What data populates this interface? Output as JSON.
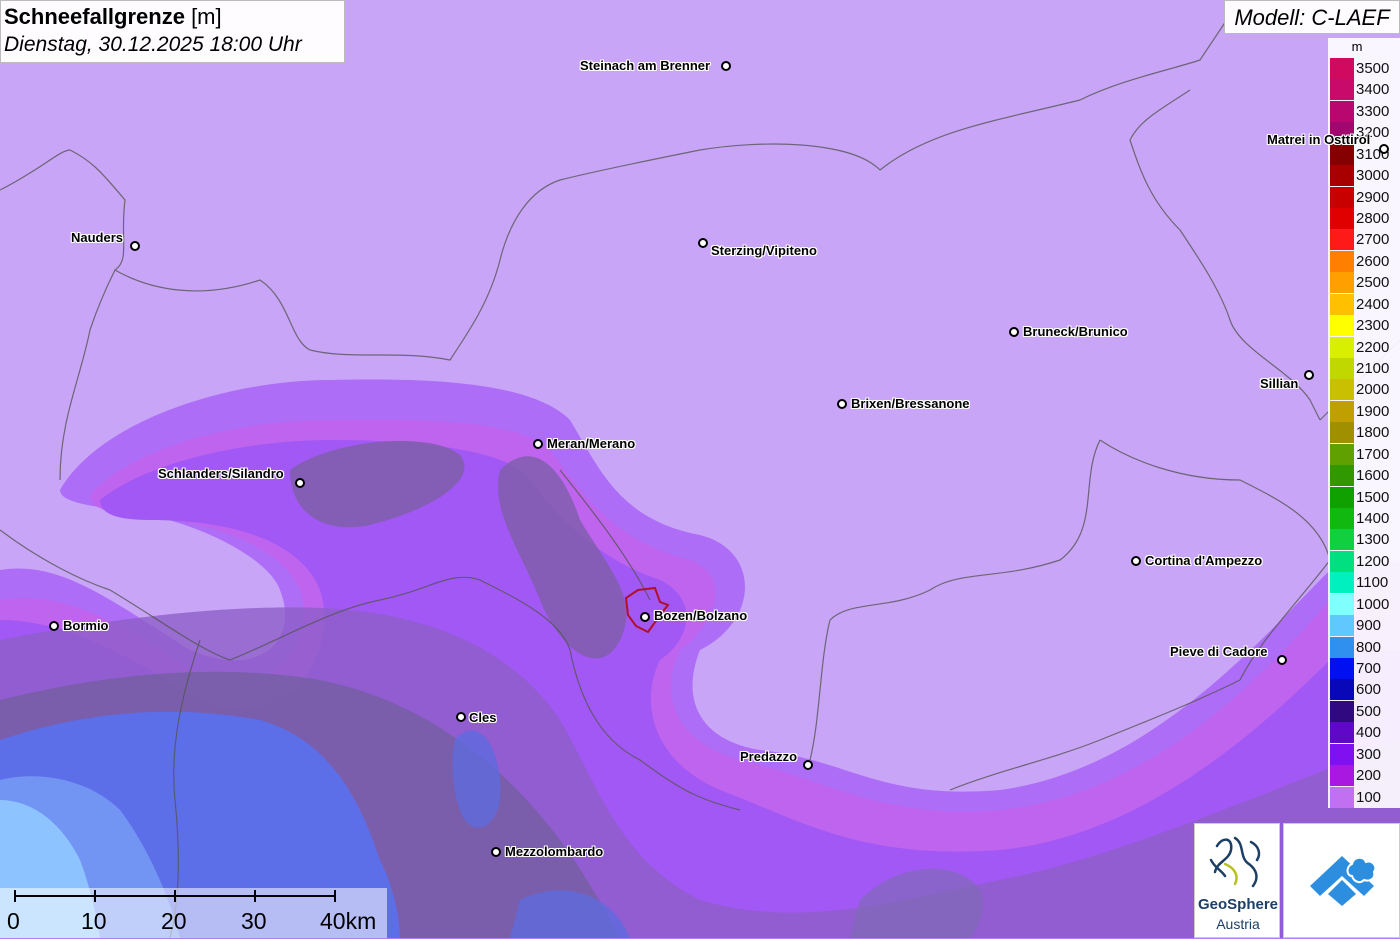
{
  "title": {
    "main_bold": "Schneefallgrenze",
    "main_unit": " [m]",
    "subtitle": "Dienstag, 30.12.2025 18:00 Uhr"
  },
  "model": "Modell: C-LAEF",
  "legend": {
    "unit": "m",
    "entries": [
      {
        "label": "3500",
        "color": "#d10a5f"
      },
      {
        "label": "3400",
        "color": "#c80a6b"
      },
      {
        "label": "3300",
        "color": "#b8086f"
      },
      {
        "label": "3200",
        "color": "#a00870"
      },
      {
        "label": "3100",
        "color": "#850000"
      },
      {
        "label": "3000",
        "color": "#a80000"
      },
      {
        "label": "2900",
        "color": "#c80000"
      },
      {
        "label": "2800",
        "color": "#e00000"
      },
      {
        "label": "2700",
        "color": "#ff1a1a"
      },
      {
        "label": "2600",
        "color": "#ff8000"
      },
      {
        "label": "2500",
        "color": "#ff9f00"
      },
      {
        "label": "2400",
        "color": "#ffc000"
      },
      {
        "label": "2300",
        "color": "#ffff00"
      },
      {
        "label": "2200",
        "color": "#d8f000"
      },
      {
        "label": "2100",
        "color": "#c0d800"
      },
      {
        "label": "2000",
        "color": "#c8c000"
      },
      {
        "label": "1900",
        "color": "#c0a000"
      },
      {
        "label": "1800",
        "color": "#a09000"
      },
      {
        "label": "1700",
        "color": "#60a000"
      },
      {
        "label": "1600",
        "color": "#309800"
      },
      {
        "label": "1500",
        "color": "#10a000"
      },
      {
        "label": "1400",
        "color": "#10b810"
      },
      {
        "label": "1300",
        "color": "#10d040"
      },
      {
        "label": "1200",
        "color": "#00e080"
      },
      {
        "label": "1100",
        "color": "#00f0c0"
      },
      {
        "label": "1000",
        "color": "#80ffff"
      },
      {
        "label": "900",
        "color": "#60c8ff"
      },
      {
        "label": "800",
        "color": "#3090f0"
      },
      {
        "label": "700",
        "color": "#0010f0"
      },
      {
        "label": "600",
        "color": "#0808b8"
      },
      {
        "label": "500",
        "color": "#300880"
      },
      {
        "label": "400",
        "color": "#6008c8"
      },
      {
        "label": "300",
        "color": "#8010f0"
      },
      {
        "label": "200",
        "color": "#a818e0"
      },
      {
        "label": "100",
        "color": "#c070f0"
      }
    ]
  },
  "cities": [
    {
      "name": "Steinach am Brenner"
    },
    {
      "name": "Nauders"
    },
    {
      "name": "Sterzing/Vipiteno"
    },
    {
      "name": "Matrei in Osttirol"
    },
    {
      "name": "Bruneck/Brunico"
    },
    {
      "name": "Sillian"
    },
    {
      "name": "Brixen/Bressanone"
    },
    {
      "name": "Meran/Merano"
    },
    {
      "name": "Schlanders/Silandro"
    },
    {
      "name": "Cortina d'Ampezzo"
    },
    {
      "name": "Bormio"
    },
    {
      "name": "Bozen/Bolzano"
    },
    {
      "name": "Pieve di Cadore"
    },
    {
      "name": "Cles"
    },
    {
      "name": "Predazzo"
    },
    {
      "name": "Mezzolombardo"
    }
  ],
  "scale": {
    "labels": [
      "0",
      "10",
      "20",
      "30",
      "40km"
    ]
  },
  "logo": {
    "name": "GeoSphere",
    "sub": "Austria"
  }
}
